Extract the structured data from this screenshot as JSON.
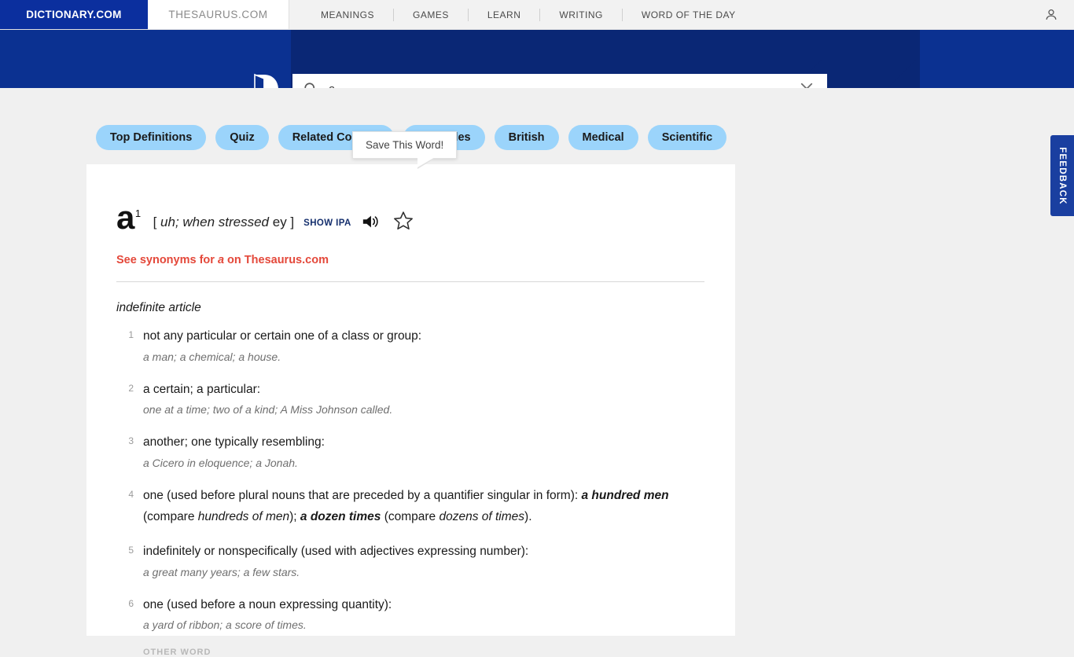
{
  "topbar": {
    "brand_tab": "DICTIONARY.COM",
    "sister_tab": "THESAURUS.COM",
    "nav_items": [
      {
        "label": "MEANINGS"
      },
      {
        "label": "GAMES"
      },
      {
        "label": "LEARN"
      },
      {
        "label": "WRITING"
      },
      {
        "label": "WORD OF THE DAY"
      }
    ],
    "account_icon": "person-icon"
  },
  "banner": {
    "logo_icon": "dictionary-d-logo",
    "search": {
      "icon": "search-icon",
      "value": "a",
      "placeholder": "",
      "clear_icon": "close-icon"
    },
    "background_color": "#0b3191"
  },
  "pills": [
    {
      "label": "Top Definitions"
    },
    {
      "label": "Quiz"
    },
    {
      "label": "Related Content"
    },
    {
      "label": "Examples"
    },
    {
      "label": "British"
    },
    {
      "label": "Medical"
    },
    {
      "label": "Scientific"
    }
  ],
  "pill_color": "#9bd4fb",
  "entry": {
    "headword": "a",
    "homograph": "1",
    "pron_open": "[ ",
    "pron_part1": "uh; when stressed",
    "pron_part2": " ey ",
    "pron_close": "]",
    "show_ipa": "SHOW IPA",
    "audio_icon": "speaker-icon",
    "save_icon": "star-outline-icon",
    "tooltip": "Save This Word!",
    "thesaurus_prefix": "See synonyms for ",
    "thesaurus_word": "a",
    "thesaurus_suffix": " on Thesaurus.com",
    "thesaurus_color": "#e4483a",
    "part_of_speech": "indefinite article",
    "definitions": [
      {
        "num": "1",
        "text": "not any particular or certain one of a class or group:",
        "example": "a man; a chemical; a house."
      },
      {
        "num": "2",
        "text": "a certain; a particular:",
        "example": "one at a time; two of a kind; A Miss Johnson called."
      },
      {
        "num": "3",
        "text": "another; one typically resembling:",
        "example": "a Cicero in eloquence; a Jonah."
      },
      {
        "num": "4",
        "text": "one (used before plural nouns that are preceded by a quantifier singular in form): ",
        "rich": [
          {
            "t": "one (used before plural nouns that are preceded by a quantifier singular in form): ",
            "s": "plain"
          },
          {
            "t": "a hundred men",
            "s": "bold-italic"
          },
          {
            "t": " (compare ",
            "s": "plain"
          },
          {
            "t": "hundreds of men",
            "s": "italic"
          },
          {
            "t": "); ",
            "s": "plain"
          },
          {
            "t": "a dozen times",
            "s": "bold-italic"
          },
          {
            "t": " (compare ",
            "s": "plain"
          },
          {
            "t": "dozens of times",
            "s": "italic"
          },
          {
            "t": ").",
            "s": "plain"
          }
        ],
        "example": ""
      },
      {
        "num": "5",
        "text": "indefinitely or nonspecifically (used with adjectives expressing number):",
        "example": "a great many years; a few stars."
      },
      {
        "num": "6",
        "text": "one (used before a noun expressing quantity):",
        "example": "a yard of ribbon; a score of times."
      }
    ],
    "cut_off_text": "OTHER WORD"
  },
  "feedback": {
    "label": "FEEDBACK",
    "color": "#1a3fa0"
  }
}
